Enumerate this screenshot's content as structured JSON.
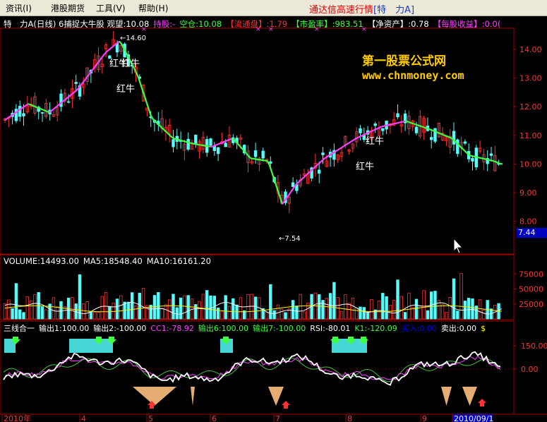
{
  "menu": {
    "items": [
      "资讯(I)",
      "港股期货",
      "工具(V)",
      "帮助(H)"
    ],
    "title_prefix": "通达信高速行情",
    "title_symbol": "[特　力A]"
  },
  "main_header": {
    "name": "特　力A(日线) 6捕捉大牛股",
    "fields": [
      {
        "text": "观望:10.08",
        "color": "#ffffff"
      },
      {
        "text": "持股:-",
        "color": "#ff40ff"
      },
      {
        "text": "空仓:10.08",
        "color": "#40ff40"
      },
      {
        "text": "【流通盘】:1.79",
        "color": "#ff3030"
      },
      {
        "text": "【市盈率】:983.51",
        "color": "#40ff40"
      },
      {
        "text": "【净资产】:0.78",
        "color": "#ffffff"
      },
      {
        "text": "【每股收益】:0.0(",
        "color": "#ff40ff"
      }
    ]
  },
  "price_axis": [
    "14.00",
    "13.00",
    "12.00",
    "11.00",
    "10.00",
    "9.00",
    "8.00"
  ],
  "current_price_label": "7.44",
  "annotations": {
    "high": "14.60",
    "low": "7.54",
    "red_bull": [
      "红牛",
      "红牛",
      "红牛",
      "红牛",
      "红牛"
    ]
  },
  "watermark": {
    "title": "第一股票公式网",
    "url": "www.chnmoney.com"
  },
  "volume_header": {
    "fields": [
      {
        "text": "VOLUME:14493.00",
        "color": "#ffffff"
      },
      {
        "text": "MA5:18548.40",
        "color": "#ffffff"
      },
      {
        "text": "MA10:16161.20",
        "color": "#ffffff"
      }
    ]
  },
  "volume_axis": [
    "75000",
    "50000",
    "25000"
  ],
  "indicator_header": {
    "fields": [
      {
        "text": "三线合一",
        "color": "#ffffff"
      },
      {
        "text": "输出1:100.00",
        "color": "#ffffff"
      },
      {
        "text": "输出2:-100.00",
        "color": "#ffffff"
      },
      {
        "text": "CC1:-78.92",
        "color": "#ff40ff"
      },
      {
        "text": "输出6:100.00",
        "color": "#40ff40"
      },
      {
        "text": "输出7:-100.00",
        "color": "#40ff40"
      },
      {
        "text": "RSI:-80.01",
        "color": "#ffffff"
      },
      {
        "text": "K1:-120.09",
        "color": "#40ff40"
      },
      {
        "text": "买入:0.00",
        "color": "#0000ff"
      },
      {
        "text": "卖出:0.00",
        "color": "#ffffff"
      },
      {
        "text": "$",
        "color": "#ffff00"
      }
    ]
  },
  "indicator_axis": [
    "150.00",
    "0.00"
  ],
  "date_axis": [
    "2010年",
    "4",
    "5",
    "6",
    "7",
    "8",
    "9",
    "2010/09/1"
  ],
  "colors": {
    "up": "#ff3232",
    "down": "#54fcfc",
    "ma_up": "#ff40ff",
    "ma_down": "#40ff40",
    "grid": "#a00000"
  }
}
